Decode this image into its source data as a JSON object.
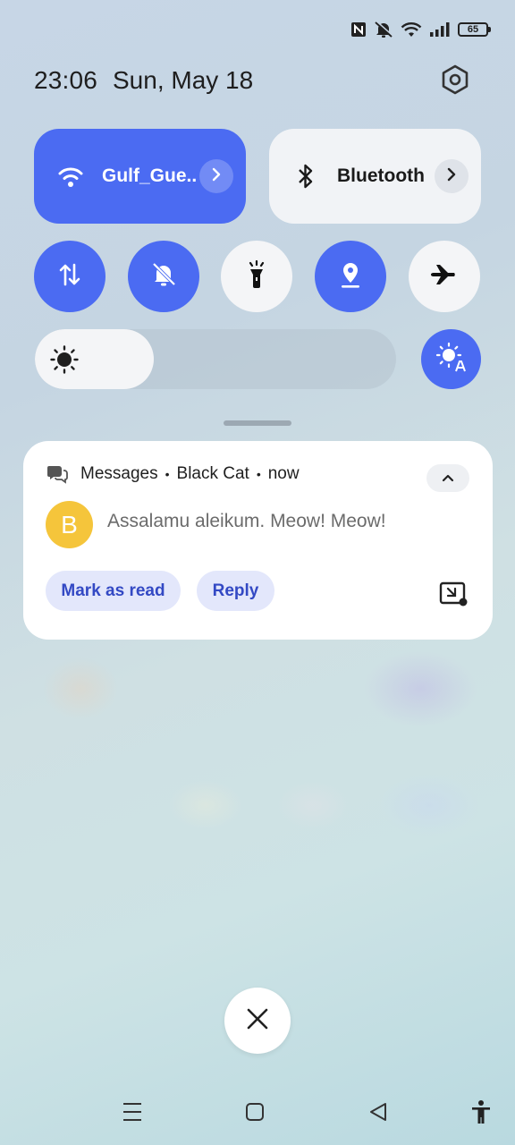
{
  "status_bar": {
    "icons": [
      "nfc-icon",
      "silent-icon",
      "wifi-icon",
      "signal-icon"
    ],
    "battery": "65"
  },
  "header": {
    "time": "23:06",
    "date": "Sun, May 18",
    "settings_icon": "gear-icon"
  },
  "quick_tiles": {
    "wifi": {
      "label": "Gulf_Gue..",
      "active": true,
      "icon": "wifi-icon"
    },
    "bluetooth": {
      "label": "Bluetooth",
      "active": false,
      "icon": "bluetooth-icon"
    },
    "toggles": [
      {
        "name": "mobile-data",
        "icon": "data-arrows-icon",
        "active": true
      },
      {
        "name": "silent",
        "icon": "bell-off-icon",
        "active": true
      },
      {
        "name": "flashlight",
        "icon": "flashlight-icon",
        "active": false
      },
      {
        "name": "location",
        "icon": "location-icon",
        "active": true
      },
      {
        "name": "airplane-mode",
        "icon": "airplane-icon",
        "active": false
      }
    ]
  },
  "brightness": {
    "level": 0.33,
    "auto": true
  },
  "notification": {
    "app": "Messages",
    "sender": "Black Cat",
    "time": "now",
    "avatar_letter": "B",
    "avatar_color": "#f5c53b",
    "text": "Assalamu aleikum. Meow! Meow!",
    "actions": {
      "mark_read": "Mark as read",
      "reply": "Reply"
    }
  },
  "colors": {
    "accent": "#4b6bf2",
    "action_bg": "#e3e7fb",
    "action_text": "#3349c4"
  },
  "nav_bar": [
    "menu-icon",
    "home-icon",
    "back-icon",
    "accessibility-icon"
  ]
}
